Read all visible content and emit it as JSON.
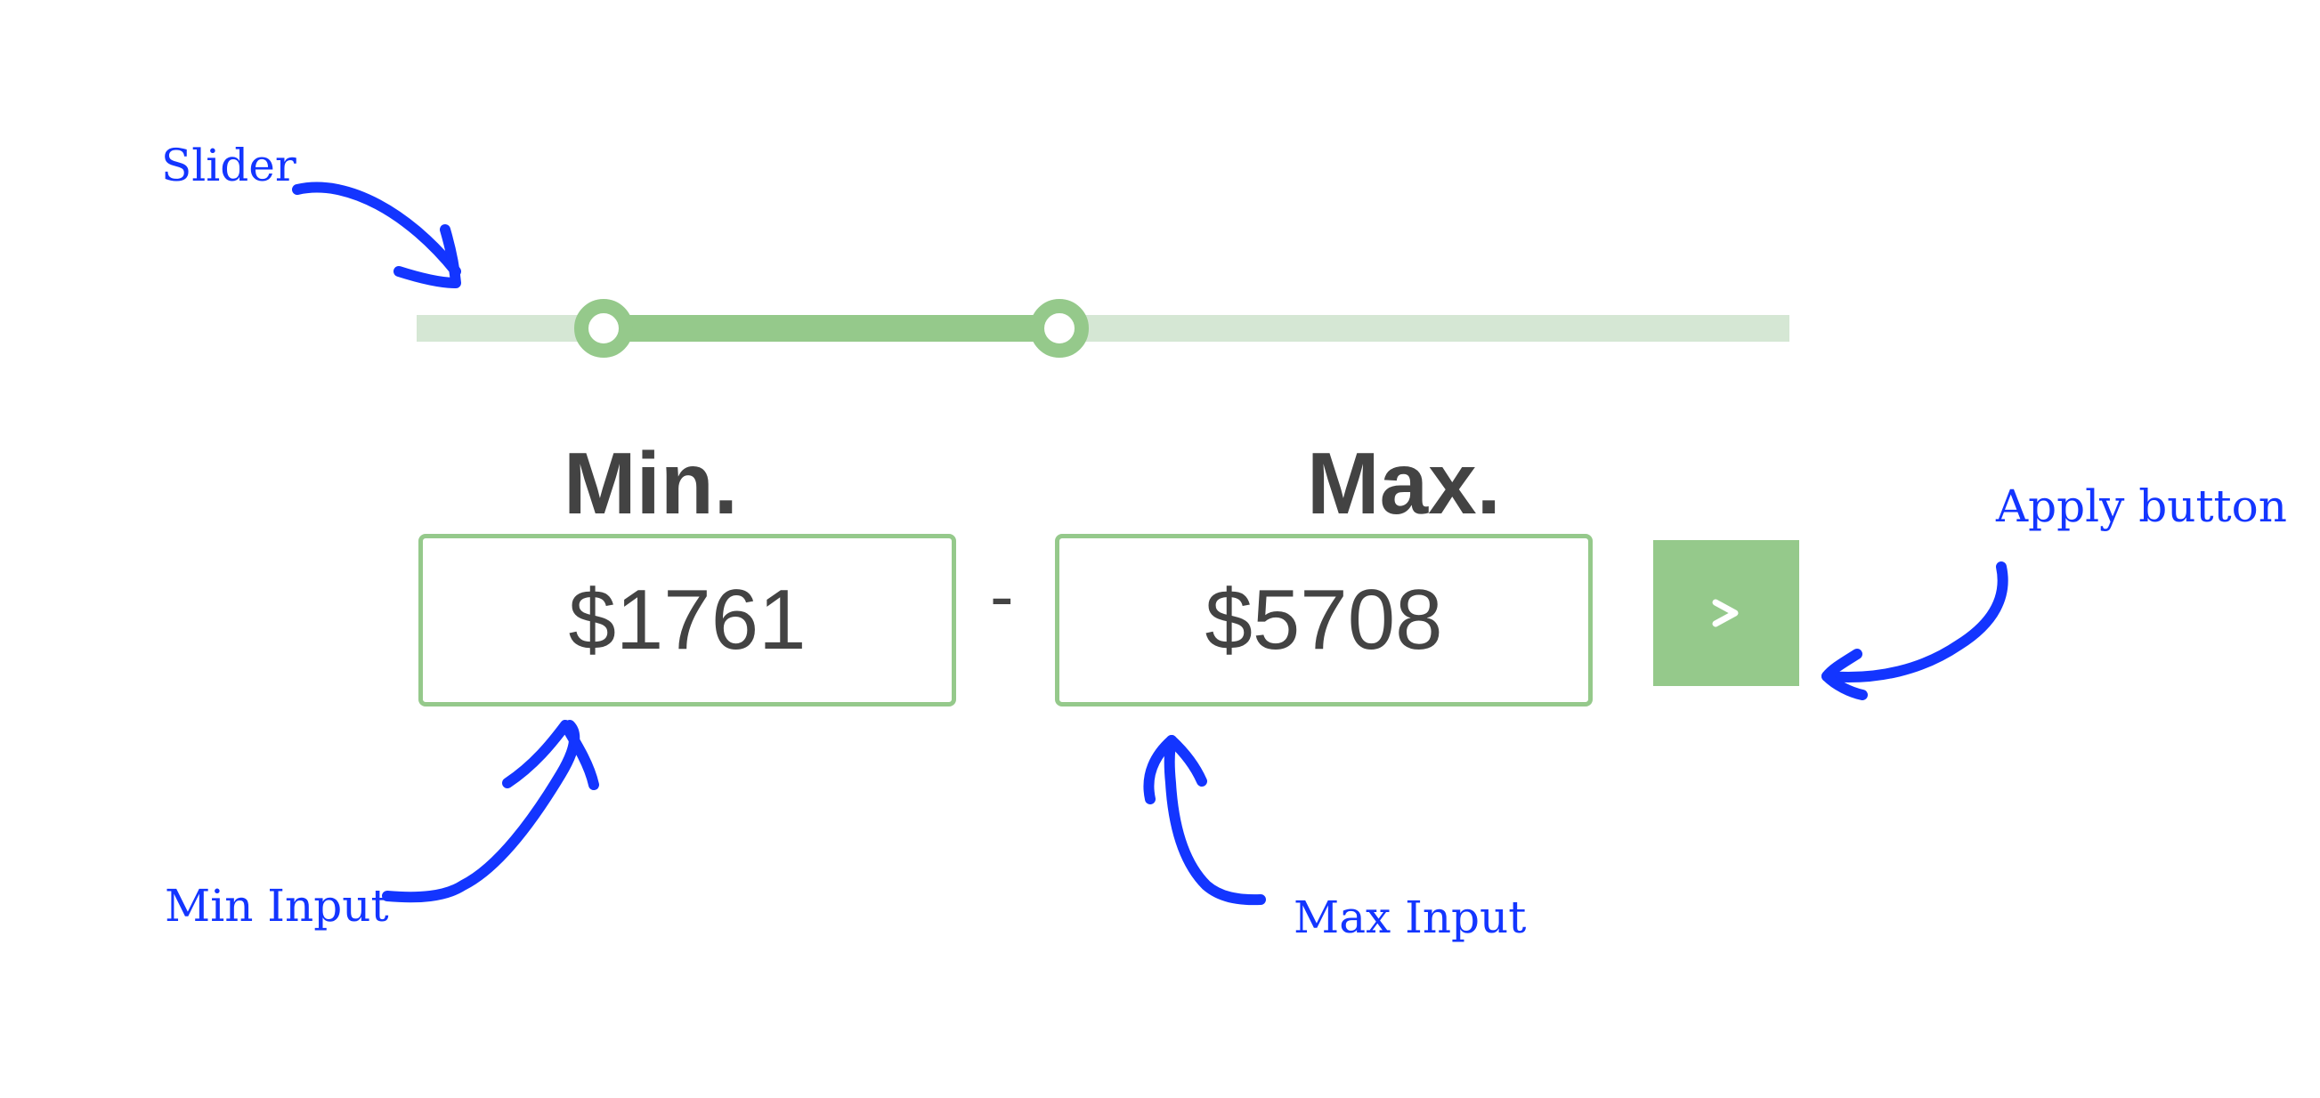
{
  "annotations": {
    "slider": "Slider",
    "apply_button": "Apply button",
    "min_input": "Min Input",
    "max_input": "Max Input"
  },
  "price_filter": {
    "min_label": "Min.",
    "max_label": "Max.",
    "min_value": "$1761",
    "max_value": "$5708",
    "separator": "-",
    "apply_icon": "chevron-right-icon",
    "slider": {
      "min_fraction": 0.136,
      "max_fraction": 0.468
    }
  },
  "colors": {
    "accent": "#95c98b",
    "track": "#d5e7d4",
    "text": "#434343",
    "annotation": "#1335ff"
  }
}
